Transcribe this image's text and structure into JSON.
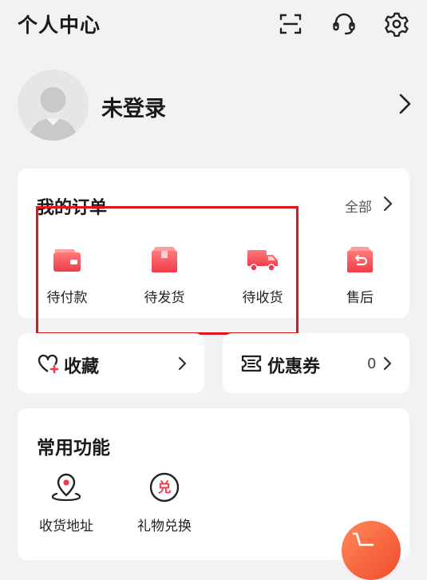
{
  "header": {
    "title": "个人中心",
    "icons": [
      "scan-icon",
      "customer-service-icon",
      "settings-icon"
    ]
  },
  "user": {
    "name": "未登录"
  },
  "orders": {
    "title": "我的订单",
    "all_label": "全部",
    "items": [
      {
        "label": "待付款",
        "icon": "wallet-icon"
      },
      {
        "label": "待发货",
        "icon": "box-icon"
      },
      {
        "label": "待收货",
        "icon": "truck-icon"
      },
      {
        "label": "售后",
        "icon": "after-sales-icon"
      }
    ]
  },
  "favorites": {
    "label": "收藏"
  },
  "coupons": {
    "label": "优惠券",
    "count": "0"
  },
  "common_functions": {
    "title": "常用功能",
    "items": [
      {
        "label": "收货地址",
        "icon": "location-pin-icon"
      },
      {
        "label": "礼物兑换",
        "icon": "redeem-icon"
      }
    ]
  },
  "colors": {
    "accent": "#f04a4a",
    "highlight_box": "#e01518",
    "background": "#f2f2f4"
  }
}
